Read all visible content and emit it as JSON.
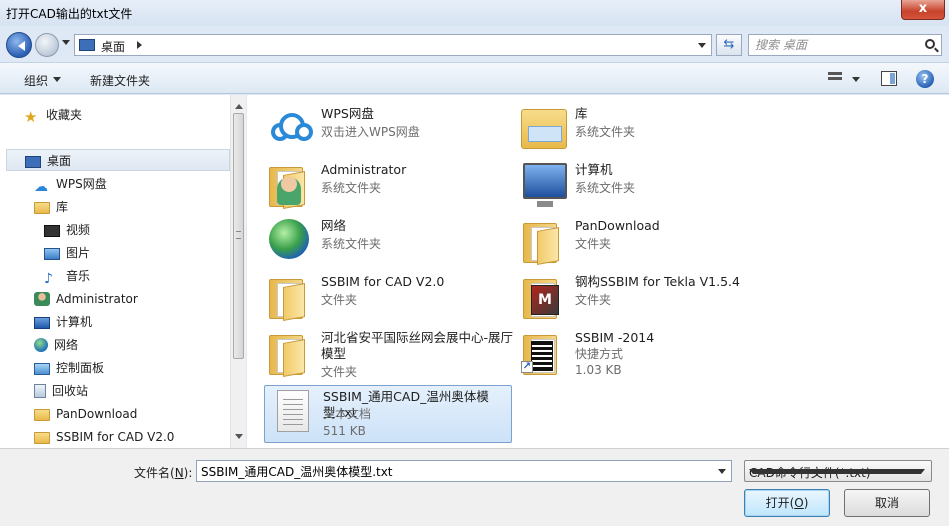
{
  "window": {
    "title": "打开CAD输出的txt文件",
    "close_glyph": "x"
  },
  "address": {
    "crumb": "桌面",
    "search_placeholder": "搜索 桌面"
  },
  "toolbar": {
    "organize": "组织",
    "new_folder": "新建文件夹",
    "help": "?"
  },
  "nav": {
    "items": [
      {
        "label": "收藏夹",
        "icon": "star-icon"
      },
      {
        "label": "桌面",
        "icon": "desktop-icon"
      },
      {
        "label": "WPS网盘",
        "icon": "cloud-icon"
      },
      {
        "label": "库",
        "icon": "library-icon"
      },
      {
        "label": "视频",
        "icon": "video-icon"
      },
      {
        "label": "图片",
        "icon": "picture-icon"
      },
      {
        "label": "音乐",
        "icon": "music-icon"
      },
      {
        "label": "Administrator",
        "icon": "user-icon"
      },
      {
        "label": "计算机",
        "icon": "computer-icon"
      },
      {
        "label": "网络",
        "icon": "network-icon"
      },
      {
        "label": "控制面板",
        "icon": "control-panel-icon"
      },
      {
        "label": "回收站",
        "icon": "recycle-bin-icon"
      },
      {
        "label": "PanDownload",
        "icon": "folder-icon"
      },
      {
        "label": "SSBIM for CAD V2.0",
        "icon": "folder-icon"
      }
    ]
  },
  "files": [
    {
      "name": "WPS网盘",
      "sub": "双击进入WPS网盘",
      "icon": "cloud-drive-icon"
    },
    {
      "name": "库",
      "sub": "系统文件夹",
      "icon": "library-icon"
    },
    {
      "name": "Administrator",
      "sub": "系统文件夹",
      "icon": "user-folder-icon"
    },
    {
      "name": "计算机",
      "sub": "系统文件夹",
      "icon": "computer-icon"
    },
    {
      "name": "网络",
      "sub": "系统文件夹",
      "icon": "network-icon"
    },
    {
      "name": "PanDownload",
      "sub": "文件夹",
      "icon": "folder-icon"
    },
    {
      "name": "SSBIM for CAD V2.0",
      "sub": "文件夹",
      "icon": "folder-icon"
    },
    {
      "name": "钢构SSBIM for Tekla V1.5.4",
      "sub": "文件夹",
      "icon": "tekla-folder-icon",
      "overlay": "M"
    },
    {
      "name": "河北省安平国际丝网会展中心-展厅模型",
      "sub": "文件夹",
      "icon": "folder-icon"
    },
    {
      "name": "SSBIM -2014",
      "sub": "快捷方式",
      "sub2": "1.03 KB",
      "icon": "shortcut-icon"
    },
    {
      "name": "SSBIM_通用CAD_温州奥体模型.txt",
      "sub": "文本文档",
      "sub2": "511 KB",
      "icon": "text-file-icon"
    }
  ],
  "footer": {
    "filename_label": "文件名(",
    "filename_key": "N",
    "filename_label_end": "):",
    "filename_value": "SSBIM_通用CAD_温州奥体模型.txt",
    "filetype": "CAD命令行文件(*.txt)",
    "open_label": "打开(",
    "open_key": "O",
    "open_label_end": ")",
    "cancel_label": "取消"
  }
}
